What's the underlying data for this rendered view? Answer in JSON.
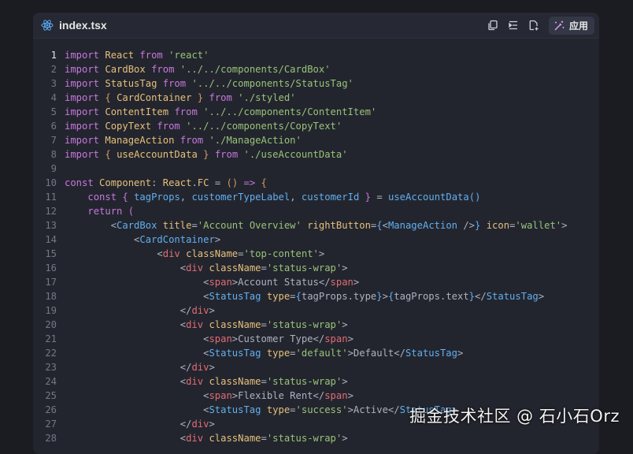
{
  "editor": {
    "filename": "index.tsx",
    "file_icon": "react-icon",
    "actions": {
      "copy_icon": "copy-icon",
      "insert_icon": "insert-at-cursor-icon",
      "new_file_icon": "new-file-icon",
      "apply_icon": "magic-wand-icon",
      "apply_label": "应用"
    },
    "active_line": 1,
    "lines": [
      {
        "n": "1",
        "t": [
          [
            "kw",
            "import "
          ],
          [
            "id",
            "React "
          ],
          [
            "kw",
            "from "
          ],
          [
            "str",
            "'react'"
          ]
        ]
      },
      {
        "n": "2",
        "t": [
          [
            "kw",
            "import "
          ],
          [
            "id",
            "CardBox "
          ],
          [
            "kw",
            "from "
          ],
          [
            "str",
            "'../../components/CardBox'"
          ]
        ]
      },
      {
        "n": "3",
        "t": [
          [
            "kw",
            "import "
          ],
          [
            "id",
            "StatusTag "
          ],
          [
            "kw",
            "from "
          ],
          [
            "str",
            "'../../components/StatusTag'"
          ]
        ]
      },
      {
        "n": "4",
        "t": [
          [
            "kw",
            "import "
          ],
          [
            "br1",
            "{ "
          ],
          [
            "id",
            "CardContainer "
          ],
          [
            "br1",
            "} "
          ],
          [
            "kw",
            "from "
          ],
          [
            "str",
            "'./styled'"
          ]
        ]
      },
      {
        "n": "5",
        "t": [
          [
            "kw",
            "import "
          ],
          [
            "id",
            "ContentItem "
          ],
          [
            "kw",
            "from "
          ],
          [
            "str",
            "'../../components/ContentItem'"
          ]
        ]
      },
      {
        "n": "6",
        "t": [
          [
            "kw",
            "import "
          ],
          [
            "id",
            "CopyText "
          ],
          [
            "kw",
            "from "
          ],
          [
            "str",
            "'../../components/CopyText'"
          ]
        ]
      },
      {
        "n": "7",
        "t": [
          [
            "kw",
            "import "
          ],
          [
            "id",
            "ManageAction "
          ],
          [
            "kw",
            "from "
          ],
          [
            "str",
            "'./ManageAction'"
          ]
        ]
      },
      {
        "n": "8",
        "t": [
          [
            "kw",
            "import "
          ],
          [
            "br1",
            "{ "
          ],
          [
            "id",
            "useAccountData "
          ],
          [
            "br1",
            "} "
          ],
          [
            "kw",
            "from "
          ],
          [
            "str",
            "'./useAccountData'"
          ]
        ]
      },
      {
        "n": "9",
        "t": []
      },
      {
        "n": "10",
        "t": [
          [
            "kw",
            "const "
          ],
          [
            "id",
            "Component"
          ],
          [
            "pl",
            ": "
          ],
          [
            "id",
            "React"
          ],
          [
            "pl",
            "."
          ],
          [
            "id",
            "FC "
          ],
          [
            "pl",
            "= "
          ],
          [
            "br1",
            "() "
          ],
          [
            "kw",
            "=> "
          ],
          [
            "br1",
            "{"
          ]
        ]
      },
      {
        "n": "11",
        "t": [
          [
            "pl",
            "    "
          ],
          [
            "kw",
            "const "
          ],
          [
            "br2",
            "{ "
          ],
          [
            "comp",
            "tagProps"
          ],
          [
            "pl",
            ", "
          ],
          [
            "comp",
            "customerTypeLabel"
          ],
          [
            "pl",
            ", "
          ],
          [
            "comp",
            "customerId "
          ],
          [
            "br2",
            "} "
          ],
          [
            "pl",
            "= "
          ],
          [
            "fn",
            "useAccountData"
          ],
          [
            "br3",
            "()"
          ]
        ]
      },
      {
        "n": "12",
        "t": [
          [
            "pl",
            "    "
          ],
          [
            "kw",
            "return "
          ],
          [
            "br2",
            "("
          ]
        ]
      },
      {
        "n": "13",
        "t": [
          [
            "pl",
            "        <"
          ],
          [
            "comp",
            "CardBox "
          ],
          [
            "attr",
            "title"
          ],
          [
            "pl",
            "="
          ],
          [
            "str",
            "'Account Overview' "
          ],
          [
            "attr",
            "rightButton"
          ],
          [
            "pl",
            "="
          ],
          [
            "br3",
            "{"
          ],
          [
            "pl",
            "<"
          ],
          [
            "comp",
            "ManageAction "
          ],
          [
            "pl",
            "/>"
          ],
          [
            "br3",
            "} "
          ],
          [
            "attr",
            "icon"
          ],
          [
            "pl",
            "="
          ],
          [
            "str",
            "'wallet'"
          ],
          [
            "pl",
            ">"
          ]
        ]
      },
      {
        "n": "14",
        "t": [
          [
            "pl",
            "            <"
          ],
          [
            "comp",
            "CardContainer"
          ],
          [
            "pl",
            ">"
          ]
        ]
      },
      {
        "n": "15",
        "t": [
          [
            "pl",
            "                <"
          ],
          [
            "tag",
            "div "
          ],
          [
            "attr",
            "className"
          ],
          [
            "pl",
            "="
          ],
          [
            "str",
            "'top-content'"
          ],
          [
            "pl",
            ">"
          ]
        ]
      },
      {
        "n": "16",
        "t": [
          [
            "pl",
            "                    <"
          ],
          [
            "tag",
            "div "
          ],
          [
            "attr",
            "className"
          ],
          [
            "pl",
            "="
          ],
          [
            "str",
            "'status-wrap'"
          ],
          [
            "pl",
            ">"
          ]
        ]
      },
      {
        "n": "17",
        "t": [
          [
            "pl",
            "                        <"
          ],
          [
            "tag",
            "span"
          ],
          [
            "pl",
            ">Account Status</"
          ],
          [
            "tag",
            "span"
          ],
          [
            "pl",
            ">"
          ]
        ]
      },
      {
        "n": "18",
        "t": [
          [
            "pl",
            "                        <"
          ],
          [
            "comp",
            "StatusTag "
          ],
          [
            "attr",
            "type"
          ],
          [
            "pl",
            "="
          ],
          [
            "br3",
            "{"
          ],
          [
            "pl",
            "tagProps.type"
          ],
          [
            "br3",
            "}"
          ],
          [
            "pl",
            ">"
          ],
          [
            "br3",
            "{"
          ],
          [
            "pl",
            "tagProps.text"
          ],
          [
            "br3",
            "}"
          ],
          [
            "pl",
            "</"
          ],
          [
            "comp",
            "StatusTag"
          ],
          [
            "pl",
            ">"
          ]
        ]
      },
      {
        "n": "19",
        "t": [
          [
            "pl",
            "                    </"
          ],
          [
            "tag",
            "div"
          ],
          [
            "pl",
            ">"
          ]
        ]
      },
      {
        "n": "20",
        "t": [
          [
            "pl",
            "                    <"
          ],
          [
            "tag",
            "div "
          ],
          [
            "attr",
            "className"
          ],
          [
            "pl",
            "="
          ],
          [
            "str",
            "'status-wrap'"
          ],
          [
            "pl",
            ">"
          ]
        ]
      },
      {
        "n": "21",
        "t": [
          [
            "pl",
            "                        <"
          ],
          [
            "tag",
            "span"
          ],
          [
            "pl",
            ">Customer Type</"
          ],
          [
            "tag",
            "span"
          ],
          [
            "pl",
            ">"
          ]
        ]
      },
      {
        "n": "22",
        "t": [
          [
            "pl",
            "                        <"
          ],
          [
            "comp",
            "StatusTag "
          ],
          [
            "attr",
            "type"
          ],
          [
            "pl",
            "="
          ],
          [
            "str",
            "'default'"
          ],
          [
            "pl",
            ">Default</"
          ],
          [
            "comp",
            "StatusTag"
          ],
          [
            "pl",
            ">"
          ]
        ]
      },
      {
        "n": "23",
        "t": [
          [
            "pl",
            "                    </"
          ],
          [
            "tag",
            "div"
          ],
          [
            "pl",
            ">"
          ]
        ]
      },
      {
        "n": "24",
        "t": [
          [
            "pl",
            "                    <"
          ],
          [
            "tag",
            "div "
          ],
          [
            "attr",
            "className"
          ],
          [
            "pl",
            "="
          ],
          [
            "str",
            "'status-wrap'"
          ],
          [
            "pl",
            ">"
          ]
        ]
      },
      {
        "n": "25",
        "t": [
          [
            "pl",
            "                        <"
          ],
          [
            "tag",
            "span"
          ],
          [
            "pl",
            ">Flexible Rent</"
          ],
          [
            "tag",
            "span"
          ],
          [
            "pl",
            ">"
          ]
        ]
      },
      {
        "n": "26",
        "t": [
          [
            "pl",
            "                        <"
          ],
          [
            "comp",
            "StatusTag "
          ],
          [
            "attr",
            "type"
          ],
          [
            "pl",
            "="
          ],
          [
            "str",
            "'success'"
          ],
          [
            "pl",
            ">Active</"
          ],
          [
            "comp",
            "StatusTag"
          ],
          [
            "pl",
            ">"
          ]
        ]
      },
      {
        "n": "27",
        "t": [
          [
            "pl",
            "                    </"
          ],
          [
            "tag",
            "div"
          ],
          [
            "pl",
            ">"
          ]
        ]
      },
      {
        "n": "28",
        "t": [
          [
            "pl",
            "                    <"
          ],
          [
            "tag",
            "div "
          ],
          [
            "attr",
            "className"
          ],
          [
            "pl",
            "="
          ],
          [
            "str",
            "'status-wrap'"
          ],
          [
            "pl",
            ">"
          ]
        ]
      }
    ]
  },
  "watermark": "掘金技术社区 @ 石小石Orz",
  "colors": {
    "background": "#1b1c22",
    "panel": "#23252e",
    "keyword": "#c678dd",
    "identifier": "#e5c07b",
    "string": "#98c379",
    "tag": "#e06c75",
    "component": "#61afef"
  }
}
